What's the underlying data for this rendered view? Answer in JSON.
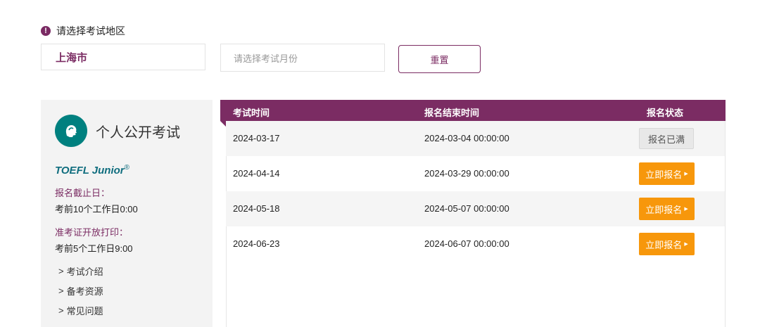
{
  "region": {
    "alert_icon": "!",
    "title": "请选择考试地区",
    "city_value": "上海市",
    "month_placeholder": "请选择考试月份",
    "reset_label": "重置"
  },
  "exam_card": {
    "type": "个人公开考试",
    "name": "TOEFL Junior",
    "trademark": "®",
    "deadline_label": "报名截止日：",
    "deadline_value": "考前10个工作日0:00",
    "admission_label": "准考证开放打印：",
    "admission_value": "考前5个工作日9:00",
    "links": [
      "考试介绍",
      "备考资源",
      "常见问题"
    ],
    "logo_icon": "head-profile-icon"
  },
  "table": {
    "headers": [
      "考试时间",
      "报名结束时间",
      "报名状态"
    ],
    "rows": [
      {
        "date": "2024-03-17",
        "end": "2024-03-04 00:00:00",
        "status": "报名已满"
      },
      {
        "date": "2024-04-14",
        "end": "2024-03-29 00:00:00",
        "status": "立即报名"
      },
      {
        "date": "2024-05-18",
        "end": "2024-05-07 00:00:00",
        "status": "立即报名"
      },
      {
        "date": "2024-06-23",
        "end": "2024-06-07 00:00:00",
        "status": "立即报名"
      }
    ]
  },
  "colors": {
    "brand": "#7b2c63",
    "accent_orange": "#f7970b",
    "logo_teal": "#00807f"
  }
}
